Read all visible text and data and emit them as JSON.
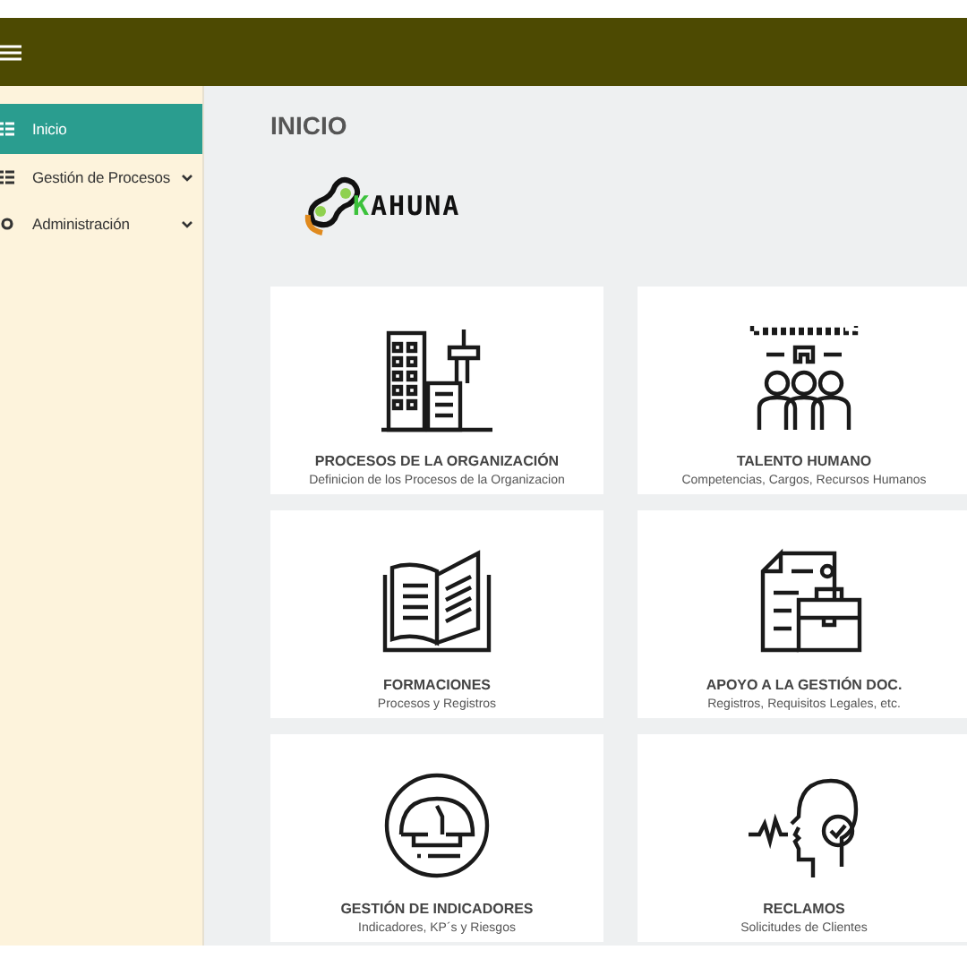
{
  "sidebar": {
    "items": [
      {
        "label": "Inicio",
        "kind": "list",
        "selected": true,
        "has_submenu": false
      },
      {
        "label": "Gestión de Procesos",
        "kind": "list",
        "selected": false,
        "has_submenu": true
      },
      {
        "label": "Administración",
        "kind": "gear",
        "selected": false,
        "has_submenu": true
      }
    ]
  },
  "page_title": "INICIO",
  "logo": {
    "initial": "K",
    "rest": "AHUNA"
  },
  "cards": [
    {
      "kind": "building",
      "title": "PROCESOS DE LA ORGANIZACIÓN",
      "subtitle": "Definicion de los Procesos de la Organizacion"
    },
    {
      "kind": "team",
      "title": "TALENTO HUMANO",
      "subtitle": "Competencias, Cargos, Recursos Humanos"
    },
    {
      "kind": "book",
      "title": "FORMACIONES",
      "subtitle": "Procesos y Registros"
    },
    {
      "kind": "document",
      "title": "APOYO A LA GESTIÓN DOC.",
      "subtitle": "Registros, Requisitos Legales, etc."
    },
    {
      "kind": "gauge",
      "title": "GESTIÓN DE INDICADORES",
      "subtitle": "Indicadores, KP´s y Riesgos"
    },
    {
      "kind": "voice",
      "title": "RECLAMOS",
      "subtitle": "Solicitudes de Clientes"
    }
  ]
}
